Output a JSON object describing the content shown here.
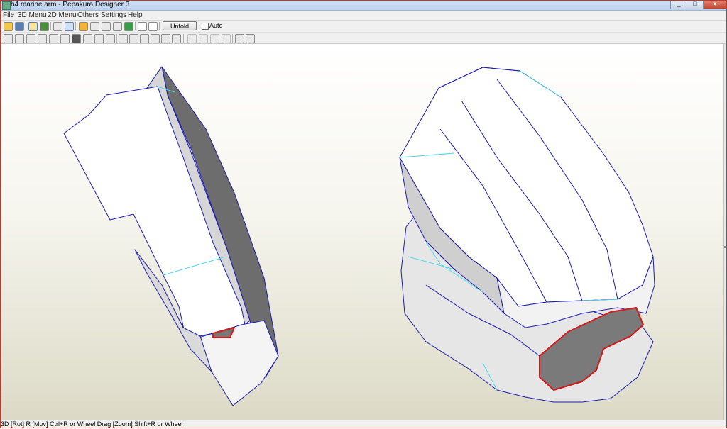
{
  "window": {
    "title": "h4 marine arm - Pepakura Designer 3",
    "controls": {
      "minimize": "_",
      "maximize": "□",
      "close": "x"
    }
  },
  "menu": {
    "items": [
      "File",
      "3D Menu",
      "2D Menu",
      "Others",
      "Settings",
      "Help"
    ]
  },
  "toolbar": {
    "unfold_label": "Unfold",
    "auto_label": "Auto",
    "auto_checked": false
  },
  "status": {
    "text": "3D [Rot] R [Mov] Ctrl+R or Wheel Drag [Zoom] Shift+R or Wheel"
  },
  "colors": {
    "edge": "#1c1cb0",
    "fold_line": "#4fd6e8",
    "cut_edge": "#d11a1a",
    "face_light": "#ffffff",
    "face_shade": "#d6d6d6",
    "face_dark": "#6d6d6d"
  }
}
